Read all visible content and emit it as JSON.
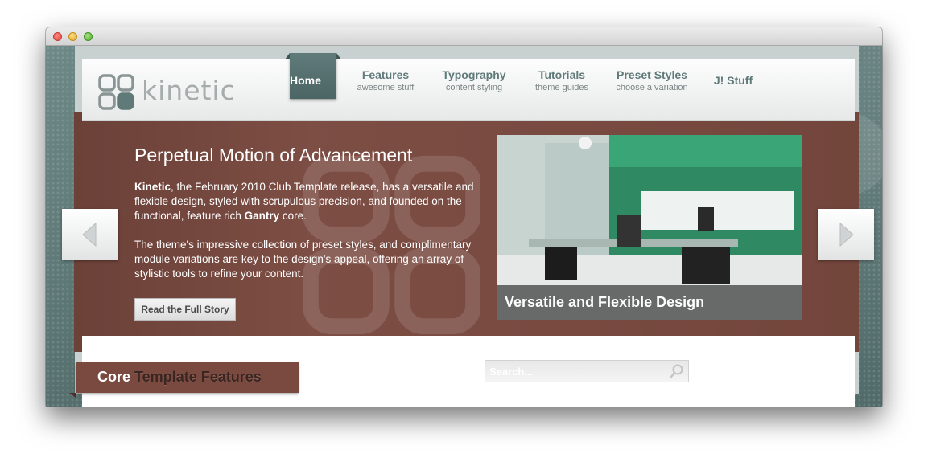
{
  "window": {
    "controls": [
      "close",
      "minimize",
      "zoom"
    ]
  },
  "logo": {
    "text": "kinetic"
  },
  "nav": {
    "items": [
      {
        "label": "Home",
        "sub": "",
        "active": true
      },
      {
        "label": "Features",
        "sub": "awesome stuff"
      },
      {
        "label": "Typography",
        "sub": "content styling"
      },
      {
        "label": "Tutorials",
        "sub": "theme guides"
      },
      {
        "label": "Preset Styles",
        "sub": "choose a variation"
      },
      {
        "label": "J! Stuff",
        "sub": ""
      }
    ]
  },
  "showcase": {
    "title": "Perpetual Motion of Advancement",
    "p1": {
      "brand": "Kinetic",
      "text1": ", the February 2010 Club Template release, has a versatile and flexible design, styled with scrupulous precision, and founded on the functional, feature rich ",
      "gantry": "Gantry",
      "text2": " core."
    },
    "p2": "The theme's impressive collection of preset styles, and complimentary module variations are key to the design's appeal, offering an array of stylistic tools to refine your content.",
    "button": "Read the Full Story",
    "caption": "Versatile and Flexible Design",
    "prev_icon": "triangle-left-icon",
    "next_icon": "triangle-right-icon"
  },
  "features": {
    "core": "Core",
    "rest": " Template Features"
  },
  "search": {
    "placeholder": "Search..."
  },
  "colors": {
    "accent": "#5f7a79",
    "showcase": "#7a4a40",
    "header": "#f4f5f5"
  }
}
